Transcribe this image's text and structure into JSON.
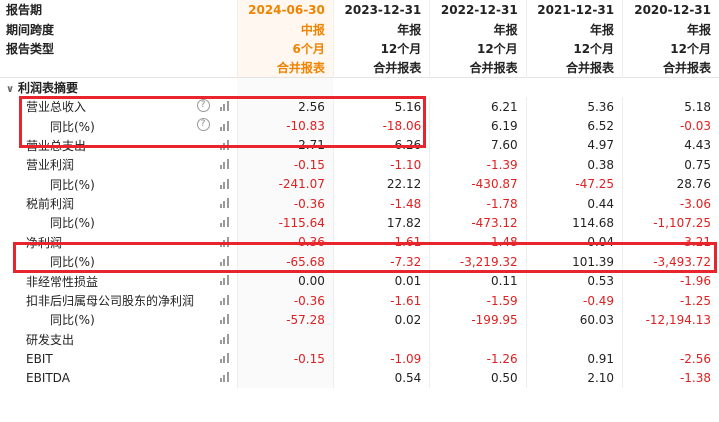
{
  "header_rows": [
    {
      "label": "报告期",
      "values": [
        "2024-06-30",
        "2023-12-31",
        "2022-12-31",
        "2021-12-31",
        "2020-12-31"
      ]
    },
    {
      "label": "期间跨度",
      "values": [
        "中报",
        "年报",
        "年报",
        "年报",
        "年报"
      ]
    },
    {
      "label": "报告类型",
      "values": [
        "6个月",
        "12个月",
        "12个月",
        "12个月",
        "12个月"
      ]
    },
    {
      "label": "",
      "values": [
        "合并报表",
        "合并报表",
        "合并报表",
        "合并报表",
        "合并报表"
      ]
    }
  ],
  "section": {
    "label": "利润表摘要",
    "caret": "∨"
  },
  "rows": [
    {
      "label": "营业总收入",
      "indent": 1,
      "help": true,
      "values": [
        "2.56",
        "5.16",
        "6.21",
        "5.36",
        "5.18"
      ]
    },
    {
      "label": "同比(%)",
      "indent": 2,
      "help": true,
      "values": [
        "-10.83",
        "-18.06",
        "6.19",
        "6.52",
        "-0.03"
      ]
    },
    {
      "label": "营业总支出",
      "indent": 1,
      "help": false,
      "values": [
        "2.71",
        "6.26",
        "7.60",
        "4.97",
        "4.43"
      ]
    },
    {
      "label": "营业利润",
      "indent": 1,
      "help": false,
      "values": [
        "-0.15",
        "-1.10",
        "-1.39",
        "0.38",
        "0.75"
      ]
    },
    {
      "label": "同比(%)",
      "indent": 2,
      "help": false,
      "values": [
        "-241.07",
        "22.12",
        "-430.87",
        "-47.25",
        "28.76"
      ]
    },
    {
      "label": "税前利润",
      "indent": 1,
      "help": false,
      "values": [
        "-0.36",
        "-1.48",
        "-1.78",
        "0.44",
        "-3.06"
      ]
    },
    {
      "label": "同比(%)",
      "indent": 2,
      "help": false,
      "values": [
        "-115.64",
        "17.82",
        "-473.12",
        "114.68",
        "-1,107.25"
      ]
    },
    {
      "label": "净利润",
      "indent": 1,
      "help": false,
      "values": [
        "-0.36",
        "-1.61",
        "-1.48",
        "0.04",
        "-3.21"
      ]
    },
    {
      "label": "同比(%)",
      "indent": 2,
      "help": false,
      "values": [
        "-65.68",
        "-7.32",
        "-3,219.32",
        "101.39",
        "-3,493.72"
      ]
    },
    {
      "label": "非经常性损益",
      "indent": 1,
      "help": false,
      "values": [
        "0.00",
        "0.01",
        "0.11",
        "0.53",
        "-1.96"
      ]
    },
    {
      "label": "扣非后归属母公司股东的净利润",
      "indent": 1,
      "help": false,
      "values": [
        "-0.36",
        "-1.61",
        "-1.59",
        "-0.49",
        "-1.25"
      ]
    },
    {
      "label": "同比(%)",
      "indent": 2,
      "help": false,
      "values": [
        "-57.28",
        "0.02",
        "-199.95",
        "60.03",
        "-12,194.13"
      ]
    },
    {
      "label": "研发支出",
      "indent": 1,
      "help": false,
      "values": [
        "",
        "",
        "",
        "",
        ""
      ]
    },
    {
      "label": "EBIT",
      "indent": 1,
      "help": false,
      "values": [
        "-0.15",
        "-1.09",
        "-1.26",
        "0.91",
        "-2.56"
      ]
    },
    {
      "label": "EBITDA",
      "indent": 1,
      "help": false,
      "values": [
        "",
        "0.54",
        "0.50",
        "2.10",
        "-1.38"
      ]
    }
  ],
  "help_glyph": "?",
  "colors": {
    "accent": "#f08300",
    "negative": "#1a9b3a",
    "positive": "#e02020",
    "highlight_box": "#e8242c"
  }
}
